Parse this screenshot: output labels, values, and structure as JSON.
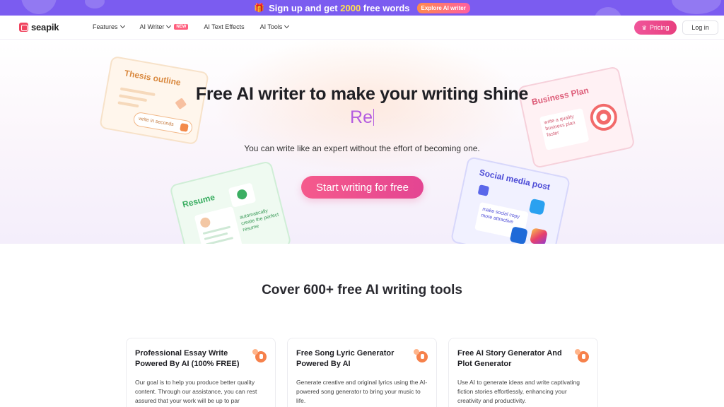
{
  "promo": {
    "text_before": "Sign up and get ",
    "highlight": "2000",
    "text_after": " free words",
    "cta": "Explore AI writer"
  },
  "nav": {
    "logo": "seapik",
    "menu": [
      {
        "label": "Features"
      },
      {
        "label": "AI Writer",
        "badge": "NEW"
      },
      {
        "label": "AI Text Effects"
      },
      {
        "label": "AI Tools"
      }
    ],
    "pricing": "Pricing",
    "login": "Log in"
  },
  "hero": {
    "title": "Free AI writer to make your writing shine",
    "typed": "Re",
    "subtitle": "You can write like an expert without the effort of becoming one.",
    "cta": "Start writing for free",
    "cards": {
      "thesis": {
        "title": "Thesis outline",
        "note": "write in seconds"
      },
      "business": {
        "title": "Business Plan",
        "note": "write a quality business plan faster"
      },
      "resume": {
        "title": "Resume",
        "note": "automatically create the perfect resume"
      },
      "social": {
        "title": "Social media post",
        "note": "make social copy more attractive"
      }
    }
  },
  "section": {
    "title": "Cover 600+ free AI writing tools",
    "tools": [
      {
        "title": "Professional Essay Write Powered By AI (100% FREE)",
        "desc": "Our goal is to help you produce better quality content. Through our assistance, you can rest assured that your work will be up to par"
      },
      {
        "title": "Free Song Lyric Generator Powered By AI",
        "desc": "Generate creative and original lyrics using the AI-powered song generator to bring your music to life."
      },
      {
        "title": "Free AI Story Generator And Plot Generator",
        "desc": "Use AI to generate ideas and write captivating fiction stories effortlessly, enhancing your creativity and productivity."
      }
    ]
  }
}
